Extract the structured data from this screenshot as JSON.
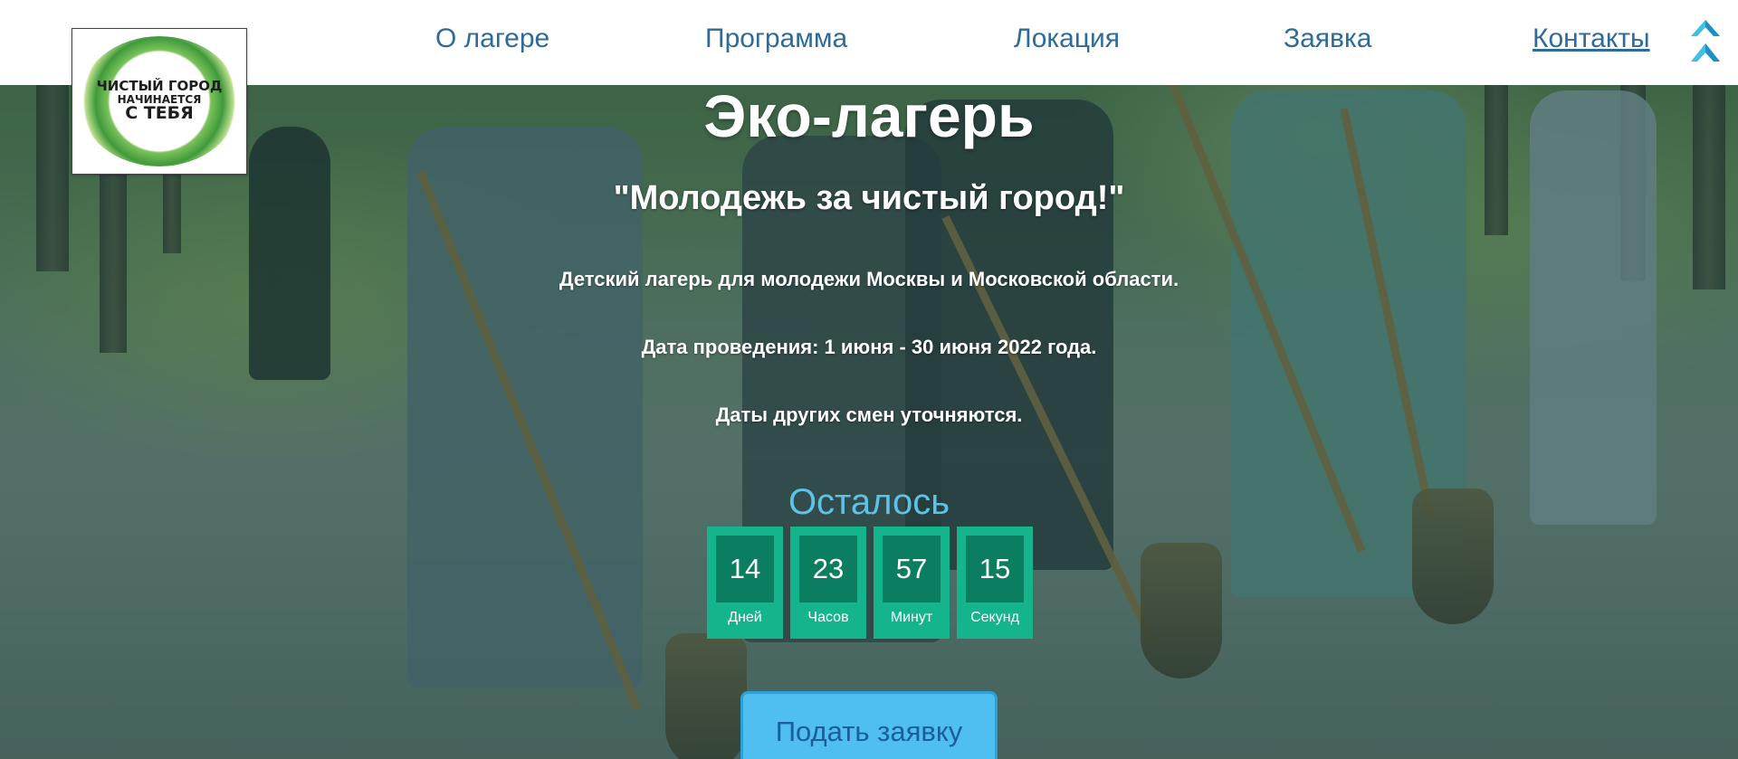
{
  "header": {
    "logo_text": [
      "ЧИСТЫЙ ГОРОД",
      "НАЧИНАЕТСЯ",
      "С ТЕБЯ"
    ],
    "nav": [
      {
        "label": "О лагере",
        "active": false
      },
      {
        "label": "Программа",
        "active": false
      },
      {
        "label": "Локация",
        "active": false
      },
      {
        "label": "Заявка",
        "active": false
      },
      {
        "label": "Контакты",
        "active": true
      }
    ],
    "scroll_top_icon": "double-chevron-up-icon"
  },
  "hero": {
    "title": "Эко-лагерь",
    "subtitle": "\"Молодежь за чистый город!\"",
    "description": "Детский лагерь для молодежи Москвы и Московской области.",
    "dates": "Дата проведения: 1 июня - 30 июня 2022 года.",
    "note": "Даты других смен уточняются.",
    "countdown_title": "Осталось",
    "countdown": [
      {
        "value": "14",
        "label": "Дней"
      },
      {
        "value": "23",
        "label": "Часов"
      },
      {
        "value": "57",
        "label": "Минут"
      },
      {
        "value": "15",
        "label": "Секунд"
      }
    ],
    "apply_button": "Подать заявку"
  },
  "colors": {
    "nav_link": "#2d6b9a",
    "countdown_outer": "#14b58d",
    "countdown_inner": "#0b7e61",
    "remaining_text": "#5dc3e6",
    "button": "#4fbef0"
  }
}
